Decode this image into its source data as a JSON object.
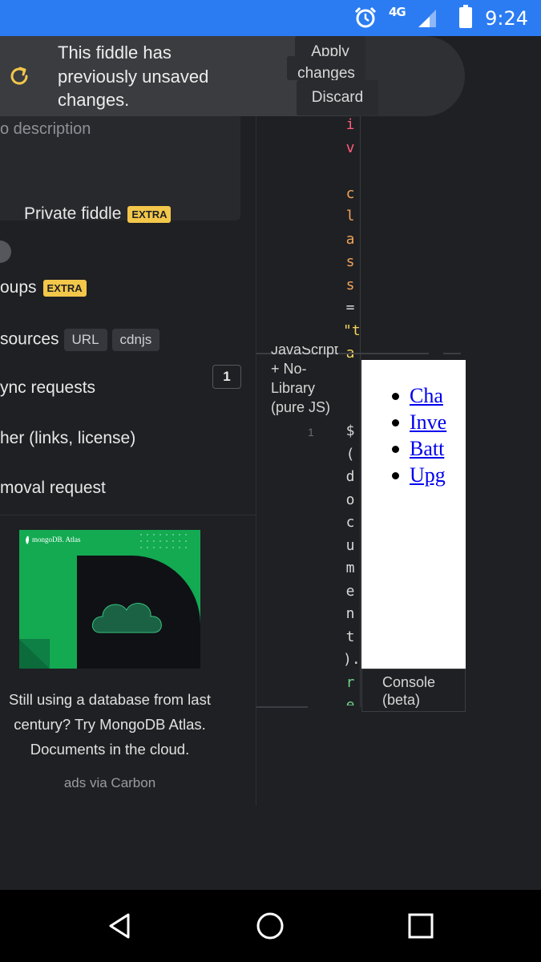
{
  "status_bar": {
    "time": "9:24",
    "network": "4G",
    "icons": [
      "alarm-icon",
      "signal-icon",
      "battery-icon"
    ]
  },
  "banner": {
    "message_lines": [
      "This fiddle has",
      "previously unsaved",
      "changes."
    ],
    "apply_label": "Apply",
    "changes_label": "changes",
    "discard_label": "Discard",
    "icon": "refresh-icon",
    "accent": "#f3c74a"
  },
  "sidebar": {
    "description_placeholder": "o description",
    "private_label": "Private fiddle",
    "extra_badge": "EXTRA",
    "groups_label": "oups",
    "resources_label": "sources",
    "chip_url": "URL",
    "chip_cdnjs": "cdnjs",
    "resources_count": "1",
    "async_label": "ync requests",
    "other_label": "her (links, license)",
    "removal_label": "moval request"
  },
  "ad": {
    "brand": "mongoDB. Atlas",
    "text_lines": [
      "Still using a database from last",
      "century? Try MongoDB Atlas.",
      "Documents in the cloud."
    ],
    "via": "ads via Carbon"
  },
  "editor": {
    "html_code_chars": [
      "i",
      "v",
      "",
      "c",
      "l",
      "a",
      "s",
      "s",
      "=",
      "\"t",
      "a"
    ],
    "js_label_lines": [
      "JavaScript",
      "+ No-",
      "Library",
      "(pure JS)"
    ],
    "line_number": "1",
    "js_code_chars": [
      "$",
      "(",
      "d",
      "o",
      "c",
      "u",
      "m",
      "e",
      "n",
      "t",
      ").",
      "r",
      "e"
    ]
  },
  "result": {
    "links": [
      "Cha",
      "Inve",
      "Batt",
      "Upg"
    ]
  },
  "console": {
    "label_lines": [
      "Console",
      "(beta)"
    ]
  }
}
